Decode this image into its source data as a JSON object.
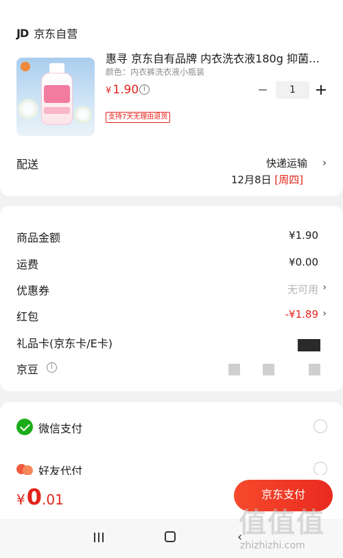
{
  "shop": {
    "logo": "JD",
    "name": "京东自营"
  },
  "product": {
    "title": "惠寻 京东自有品牌 内衣洗衣液180g 抑菌…",
    "spec": "颜色：内衣裤洗衣液小瓶装",
    "price_symbol": "¥",
    "price": "1.90",
    "info_glyph": "i",
    "quantity": "1",
    "return_policy": "支持7天无理由退货"
  },
  "delivery": {
    "label": "配送",
    "method": "快递运输",
    "date": "12月8日",
    "weekday": "[周四]",
    "chevron": "›"
  },
  "fees": {
    "goods_amount": {
      "label": "商品金额",
      "value": "¥1.90"
    },
    "shipping": {
      "label": "运费",
      "value": "¥0.00"
    },
    "coupon": {
      "label": "优惠券",
      "value": "无可用",
      "chevron": "›"
    },
    "red_packet": {
      "label": "红包",
      "value": "-¥1.89",
      "chevron": "›"
    },
    "gift_card": {
      "label": "礼品卡(京东卡/E卡)"
    },
    "jingdou": {
      "label": "京豆",
      "info_glyph": "i"
    }
  },
  "payment": {
    "methods": [
      {
        "label": "微信支付"
      },
      {
        "label": "好友代付"
      }
    ]
  },
  "footer": {
    "currency": "¥",
    "total_int": "0",
    "total_dec": ".01",
    "pay_button": "京东支付"
  },
  "nav": {
    "back_glyph": "‹"
  },
  "watermark": {
    "text": "值值值",
    "url": "zhizhizhi.com"
  },
  "colors": {
    "accent": "#e2231a",
    "wechat": "#1aad19"
  }
}
